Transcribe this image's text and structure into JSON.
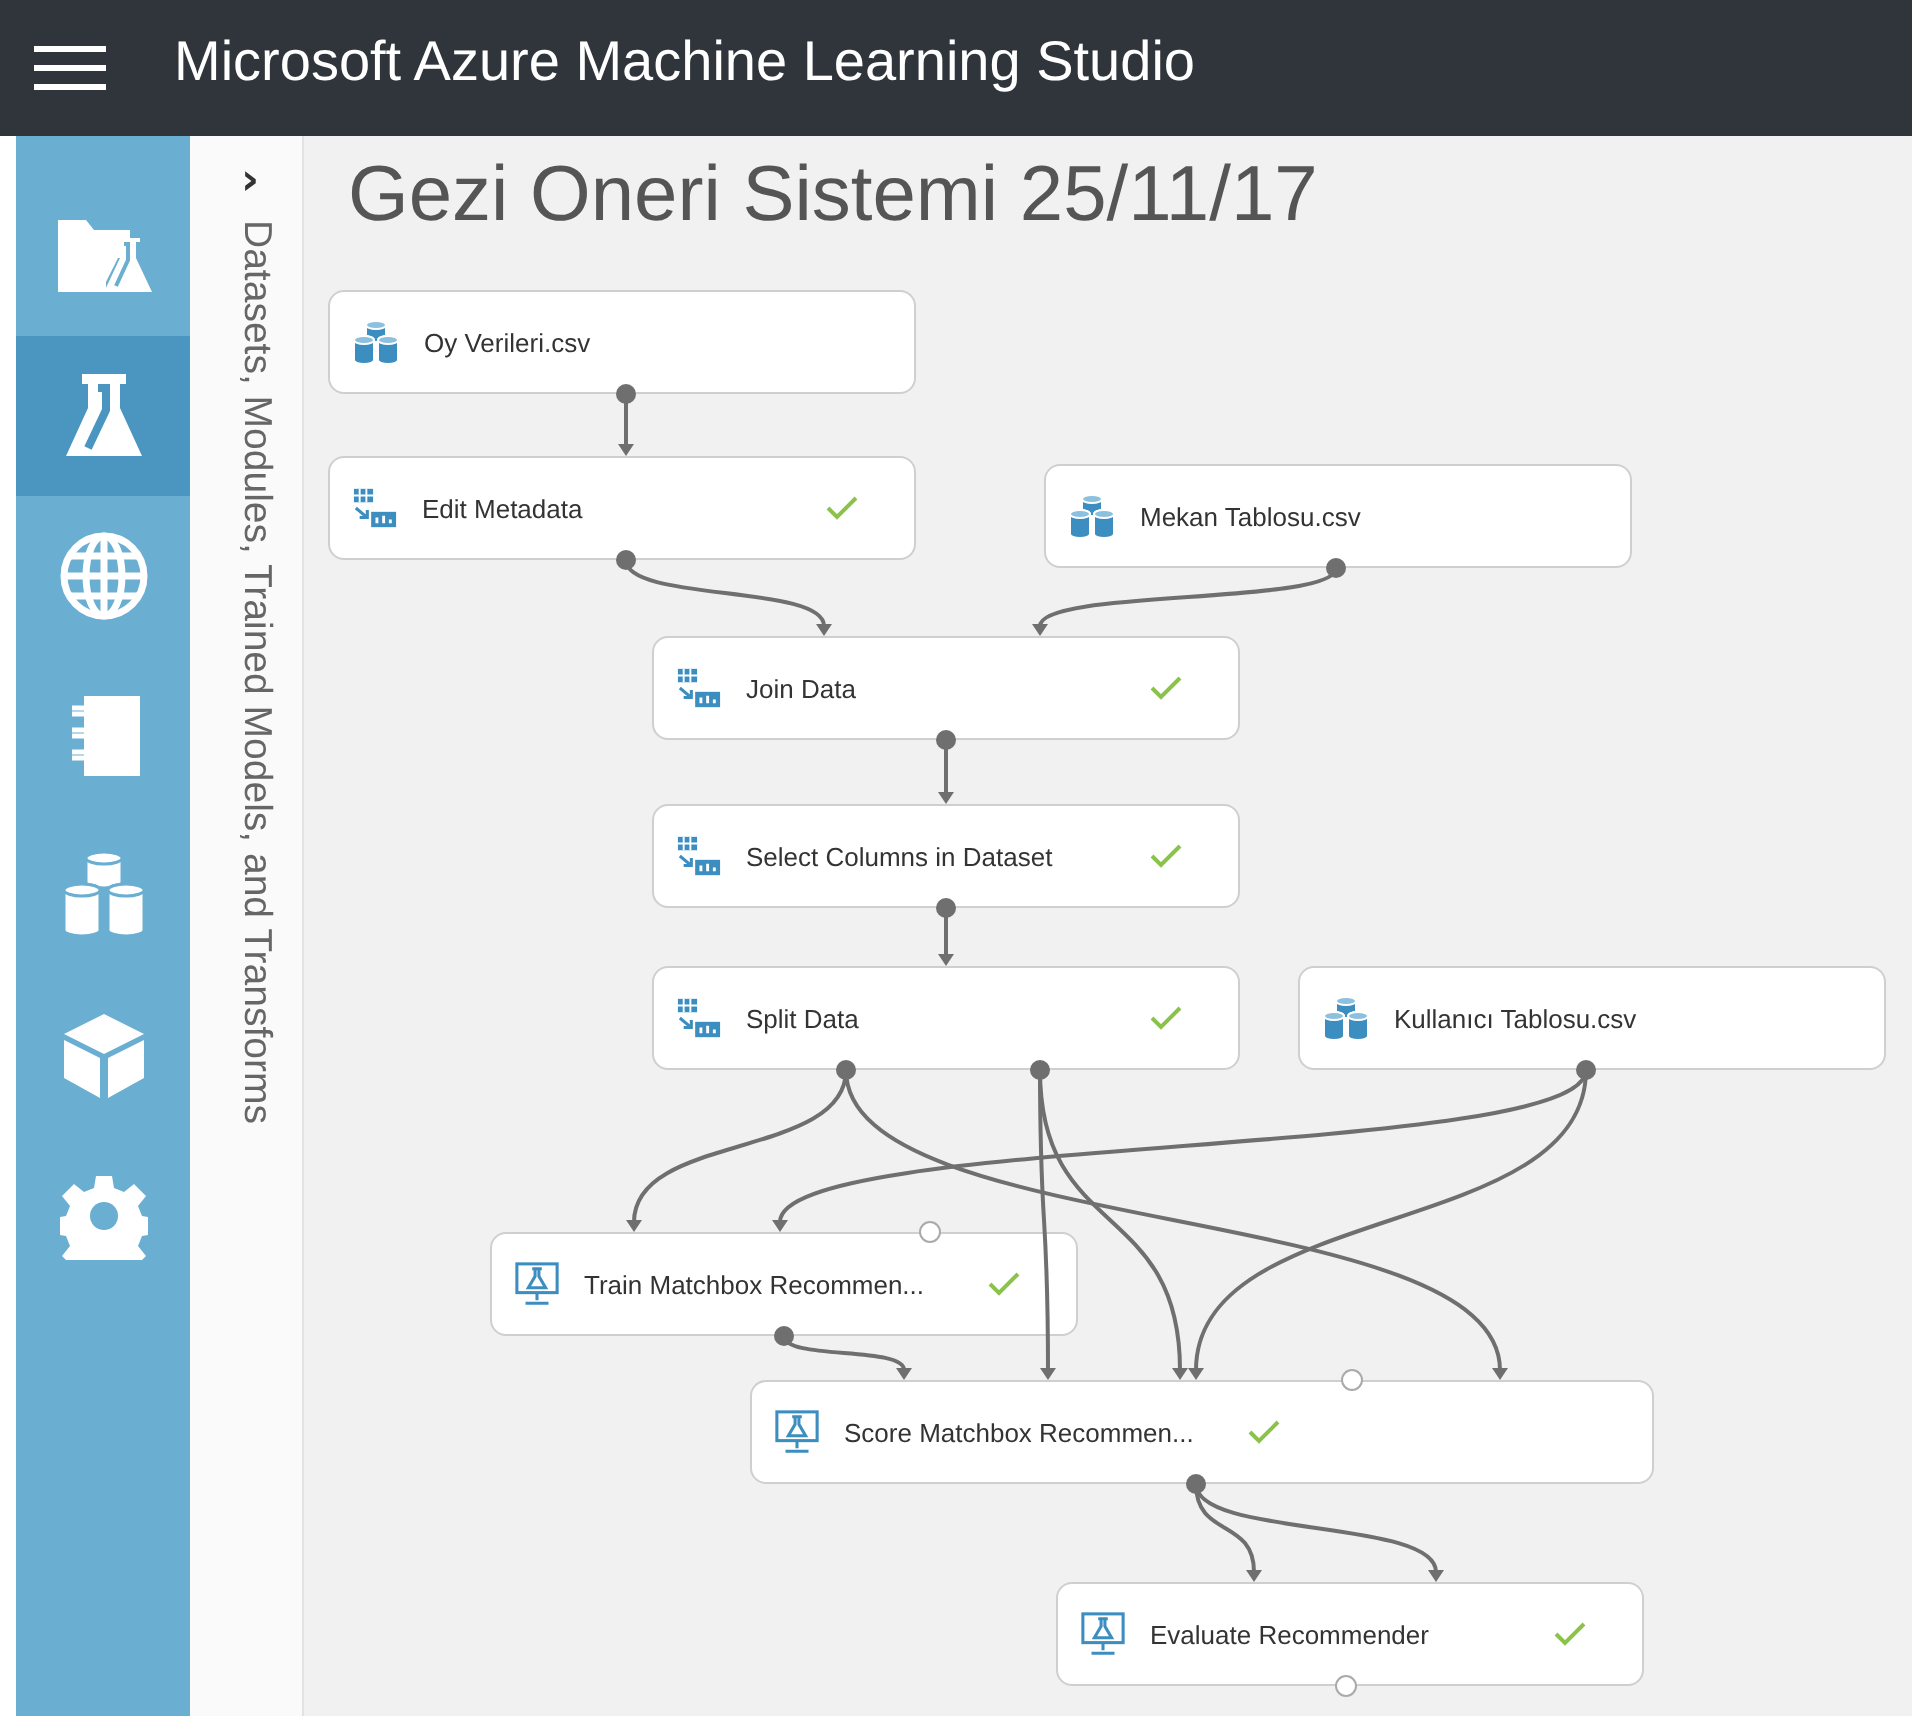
{
  "app": {
    "title": "Microsoft Azure Machine Learning Studio"
  },
  "nav_items": [
    {
      "kind": "projects",
      "selected": false
    },
    {
      "kind": "experiments",
      "selected": true
    },
    {
      "kind": "web-services",
      "selected": false
    },
    {
      "kind": "notebooks",
      "selected": false
    },
    {
      "kind": "datasets",
      "selected": false
    },
    {
      "kind": "trained-models",
      "selected": false
    },
    {
      "kind": "settings",
      "selected": false
    }
  ],
  "palette": {
    "toggle": "›",
    "label": "Datasets, Modules, Trained Models, and Transforms"
  },
  "experiment": {
    "title": "Gezi Oneri Sistemi 25/11/17",
    "modules": [
      {
        "kind": "dataset",
        "name": "Oy Verileri.csv",
        "done": false
      },
      {
        "kind": "transform",
        "name": "Edit Metadata",
        "done": true
      },
      {
        "kind": "dataset",
        "name": "Mekan Tablosu.csv",
        "done": false
      },
      {
        "kind": "transform",
        "name": "Join Data",
        "done": true
      },
      {
        "kind": "transform",
        "name": "Select Columns in Dataset",
        "done": true
      },
      {
        "kind": "transform",
        "name": "Split Data",
        "done": true
      },
      {
        "kind": "dataset",
        "name": "Kullanıcı Tablosu.csv",
        "done": false
      },
      {
        "kind": "model",
        "name": "Train Matchbox Recommen...",
        "done": true
      },
      {
        "kind": "model",
        "name": "Score Matchbox Recommen...",
        "done": true
      },
      {
        "kind": "model",
        "name": "Evaluate Recommender",
        "done": true
      }
    ]
  }
}
